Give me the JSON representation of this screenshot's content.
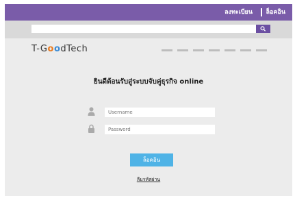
{
  "topbar": {
    "register_label": "ลงทะเบียน",
    "login_label": "ล็อคอิน",
    "bg_color": "#7a5ca9"
  },
  "search": {
    "placeholder": "",
    "icon": "search-icon"
  },
  "brand": {
    "prefix": "T-G",
    "o1": "o",
    "o2": "o",
    "suffix": "dTech"
  },
  "page_title": "ยินดีต้อนรับสู่ระบบจับคู่ธุรกิจ online",
  "form": {
    "username_placeholder": "Username",
    "password_placeholder": "Password",
    "username_icon": "user-icon",
    "password_icon": "lock-icon",
    "login_button_label": "ล็อคอิน",
    "forgot_password_label": "ลืมรหัสผ่าน"
  },
  "colors": {
    "accent": "#4fb3e6",
    "search_button": "#6b4fa2"
  }
}
